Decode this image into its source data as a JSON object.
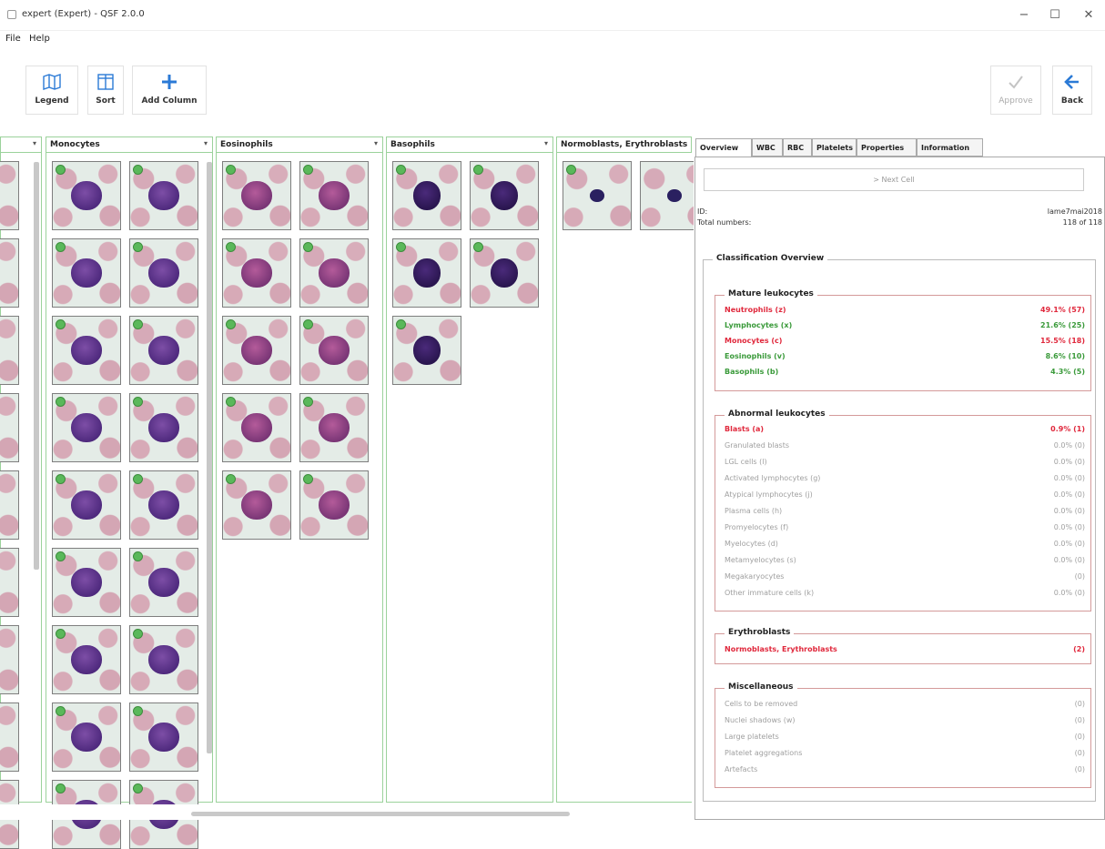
{
  "window": {
    "title": "expert (Expert) - QSF 2.0.0",
    "minimize": "−",
    "maximize": "☐",
    "close": "✕"
  },
  "menu": [
    "File",
    "Help"
  ],
  "toolbar": {
    "legend": "Legend",
    "sort": "Sort",
    "add_column": "Add Column",
    "approve": "Approve",
    "back": "Back"
  },
  "columns": [
    {
      "name": "Monocytes",
      "count": 18
    },
    {
      "name": "Eosinophils",
      "count": 10
    },
    {
      "name": "Basophils",
      "count": 5
    },
    {
      "name": "Normoblasts, Erythroblasts",
      "count": 2
    }
  ],
  "tabs": [
    "Overview",
    "WBC",
    "RBC",
    "Platelets",
    "Properties",
    "Information"
  ],
  "overview": {
    "next_cell": "> Next Cell",
    "id_label": "ID:",
    "id_value": "lame7mai2018",
    "total_label": "Total numbers:",
    "total_value": "118 of 118",
    "classification_title": "Classification Overview",
    "mature": {
      "title": "Mature leukocytes",
      "rows": [
        {
          "label": "Neutrophils (z)",
          "value": "49.1% (57)",
          "color": "red"
        },
        {
          "label": "Lymphocytes (x)",
          "value": "21.6% (25)",
          "color": "green"
        },
        {
          "label": "Monocytes (c)",
          "value": "15.5% (18)",
          "color": "red"
        },
        {
          "label": "Eosinophils (v)",
          "value": "8.6% (10)",
          "color": "green"
        },
        {
          "label": "Basophils (b)",
          "value": "4.3% (5)",
          "color": "green"
        }
      ]
    },
    "abnormal": {
      "title": "Abnormal leukocytes",
      "rows": [
        {
          "label": "Blasts (a)",
          "value": "0.9% (1)",
          "color": "red"
        },
        {
          "label": "Granulated blasts",
          "value": "0.0% (0)",
          "color": "grey"
        },
        {
          "label": "LGL cells (l)",
          "value": "0.0% (0)",
          "color": "grey"
        },
        {
          "label": "Activated lymphocytes (g)",
          "value": "0.0% (0)",
          "color": "grey"
        },
        {
          "label": "Atypical lymphocytes (j)",
          "value": "0.0% (0)",
          "color": "grey"
        },
        {
          "label": "Plasma cells (h)",
          "value": "0.0% (0)",
          "color": "grey"
        },
        {
          "label": "Promyelocytes (f)",
          "value": "0.0% (0)",
          "color": "grey"
        },
        {
          "label": "Myelocytes (d)",
          "value": "0.0% (0)",
          "color": "grey"
        },
        {
          "label": "Metamyelocytes (s)",
          "value": "0.0% (0)",
          "color": "grey"
        },
        {
          "label": "Megakaryocytes",
          "value": "(0)",
          "color": "grey"
        },
        {
          "label": "Other immature cells (k)",
          "value": "0.0% (0)",
          "color": "grey"
        }
      ]
    },
    "erythroblasts": {
      "title": "Erythroblasts",
      "rows": [
        {
          "label": "Normoblasts, Erythroblasts",
          "value": "(2)",
          "color": "red"
        }
      ]
    },
    "misc": {
      "title": "Miscellaneous",
      "rows": [
        {
          "label": "Cells to be removed",
          "value": "(0)",
          "color": "grey"
        },
        {
          "label": "Nuclei shadows (w)",
          "value": "(0)",
          "color": "grey"
        },
        {
          "label": "Large platelets",
          "value": "(0)",
          "color": "grey"
        },
        {
          "label": "Platelet aggregations",
          "value": "(0)",
          "color": "grey"
        },
        {
          "label": "Artefacts",
          "value": "(0)",
          "color": "grey"
        }
      ]
    }
  },
  "colors": {
    "accent": "#2b7ad6",
    "green_border": "#9bd29b",
    "red": "#e0283c",
    "green": "#3a9a3a"
  }
}
